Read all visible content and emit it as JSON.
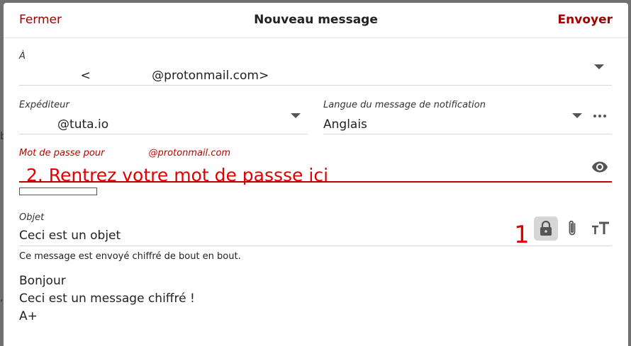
{
  "header": {
    "close_label": "Fermer",
    "title": "Nouveau message",
    "send_label": "Envoyer"
  },
  "recipient": {
    "label": "À",
    "value": "                <                @protonmail.com>"
  },
  "sender": {
    "label": "Expéditeur",
    "value": "          @tuta.io"
  },
  "notification_language": {
    "label": "Langue du message de notification",
    "value": "Anglais"
  },
  "password": {
    "label_prefix": "Mot de passe pour",
    "label_email": "@protonmail.com",
    "annotation": "2. Rentrez votre mot de passse ici",
    "strength_percent": 0
  },
  "subject": {
    "label": "Objet",
    "value": "Ceci est un objet",
    "annotation": "1"
  },
  "encryption_hint": "Ce message est envoyé chiffré de bout en bout.",
  "body_lines": [
    "Bonjour",
    "Ceci est un message chiffré !",
    "A+"
  ],
  "icons": {
    "eye": "eye-icon",
    "lock": "lock-icon",
    "attach": "paperclip-icon",
    "format": "text-size-icon",
    "more": "more-icon"
  },
  "colors": {
    "accent": "#a10000",
    "error": "#c00000",
    "annotation": "#e00000"
  }
}
